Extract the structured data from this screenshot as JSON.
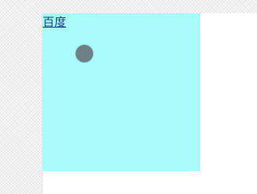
{
  "link": {
    "label": "百度"
  },
  "colors": {
    "panel": "#aafcfc",
    "link": "#1a3c8c",
    "dot": "#6f7f86",
    "page": "#ffffff"
  },
  "icons": {
    "cursor": "touch-cursor-dot"
  }
}
